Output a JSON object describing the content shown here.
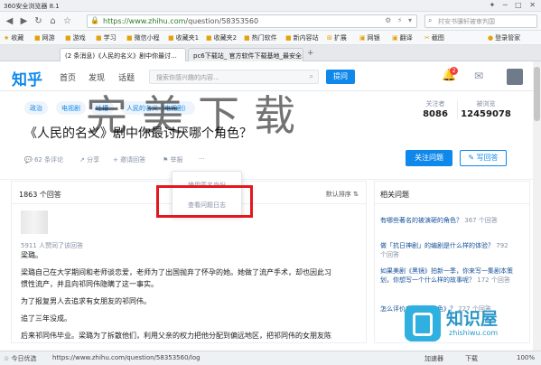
{
  "window": {
    "title": "360安全浏览器 8.1",
    "controls": "✦ ─ □ ✕"
  },
  "address": {
    "lock": "🔒",
    "url_host": "https://www.zhihu.com",
    "url_path": "/question/58353560",
    "tail": "⚙ ⚡ ▾",
    "search_placeholder": "村安书骥轩被审判国"
  },
  "bookmarks": [
    "收藏",
    "网游",
    "游戏",
    "学习",
    "微信小程",
    "收藏夹1",
    "收藏夹2",
    "热门软件",
    "新内容站",
    "扩展",
    "网银",
    "翻译",
    "截图",
    "登录管家"
  ],
  "tabs": [
    {
      "label": "(2 条消息)《人民的名义》剧中你最讨..."
    },
    {
      "label": "pc6下载站_ 官方软件下载基地_最安全..."
    }
  ],
  "zhihu": {
    "logo": "知乎",
    "nav": [
      "首页",
      "发现",
      "话题"
    ],
    "search_placeholder": "搜索你感兴趣的内容...",
    "ask_label": "提问",
    "badge": "2"
  },
  "question": {
    "topics": [
      "政治",
      "电视剧",
      "吐槽",
      "人民的名义（电视剧）"
    ],
    "title": "《人民的名义》剧中你最讨厌哪个角色？",
    "followers_label": "关注者",
    "followers": "8086",
    "views_label": "被浏览",
    "views": "12459078",
    "actions": [
      "62 条评论",
      "分享",
      "邀请回答",
      "举报",
      "···"
    ],
    "follow_label": "关注问题",
    "write_label": "写回答"
  },
  "dropdown": {
    "items": [
      "使用匿名身份",
      "查看问题日志"
    ]
  },
  "answers": {
    "count": "1863 个回答",
    "sort": "默认排序 ⇅",
    "likes": "5911 人赞同了该回答",
    "paragraphs": [
      "梁璐。",
      "梁璐自己在大学期间和老师谈恋爱，老师为了出国抛弃了怀孕的她。她做了流产手术，却也因此习",
      "惯性流产，并且向祁同伟隐瞒了这一事实。",
      "为了报复男人去追求有女朋友的祁同伟。",
      "追了三年没成。",
      "后来祁同伟毕业。梁璐为了拆散他们，利用父亲的权力把他分配到偏远地区，把祁同伟的女朋友陈"
    ]
  },
  "related": {
    "title": "相关问题",
    "items": [
      {
        "q": "有哪些著名的被演砸的角色？",
        "cnt": "367 个回答"
      },
      {
        "q": "做「抗日神剧」的编剧是什么样的体验？",
        "cnt": "792 个回答"
      },
      {
        "q": "如果美剧《黑镜》拍新一季，你来写一集剧本策划，你想写一个什么样的故事呢？",
        "cnt": "172 个回答"
      },
      {
        "q": "怎么评价电视剧《红色》？",
        "cnt": "227 个回答"
      }
    ]
  },
  "watermark": "完美下载",
  "brand": {
    "name": "知识屋",
    "url": "zhishiwu.com"
  },
  "statusbar": {
    "left": "☆ 今日优选",
    "url": "https://www.zhihu.com/question/58353560/log",
    "right": [
      "加速器",
      "下载",
      "100%"
    ]
  }
}
